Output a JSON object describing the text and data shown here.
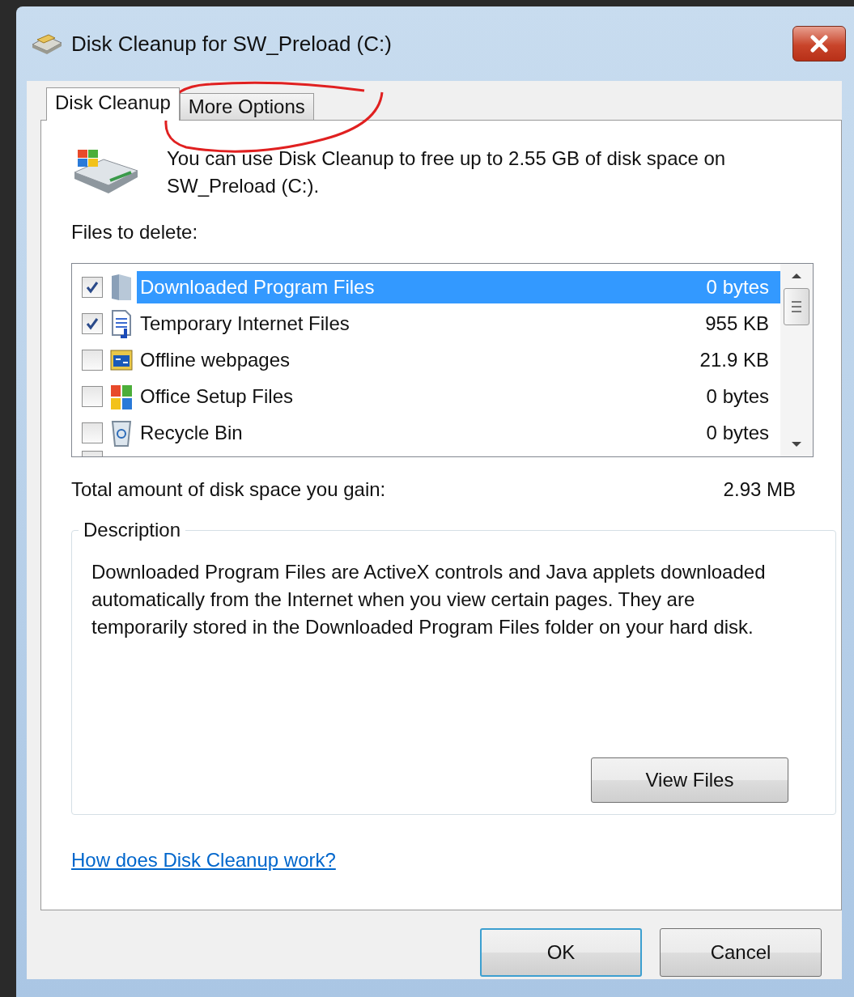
{
  "window": {
    "title": "Disk Cleanup for SW_Preload (C:)"
  },
  "tabs": [
    {
      "label": "Disk Cleanup",
      "selected": true
    },
    {
      "label": "More Options",
      "selected": false
    }
  ],
  "intro": "You can use Disk Cleanup to free up to 2.55 GB of disk space on SW_Preload (C:).",
  "files_label": "Files to delete:",
  "files": [
    {
      "name": "Downloaded Program Files",
      "size": "0 bytes",
      "checked": true,
      "selected": true
    },
    {
      "name": "Temporary Internet Files",
      "size": "955 KB",
      "checked": true,
      "selected": false
    },
    {
      "name": "Offline webpages",
      "size": "21.9 KB",
      "checked": false,
      "selected": false
    },
    {
      "name": "Office Setup Files",
      "size": "0 bytes",
      "checked": false,
      "selected": false
    },
    {
      "name": "Recycle Bin",
      "size": "0 bytes",
      "checked": false,
      "selected": false
    }
  ],
  "total": {
    "label": "Total amount of disk space you gain:",
    "value": "2.93 MB"
  },
  "description": {
    "title": "Description",
    "text": "Downloaded Program Files are ActiveX controls and Java applets downloaded automatically from the Internet when you view certain pages. They are temporarily stored in the Downloaded Program Files folder on your hard disk.",
    "button": "View Files"
  },
  "help_link": "How does Disk Cleanup work?",
  "buttons": [
    {
      "label": "OK",
      "kind": "default"
    },
    {
      "label": "Cancel",
      "kind": "normal"
    }
  ]
}
